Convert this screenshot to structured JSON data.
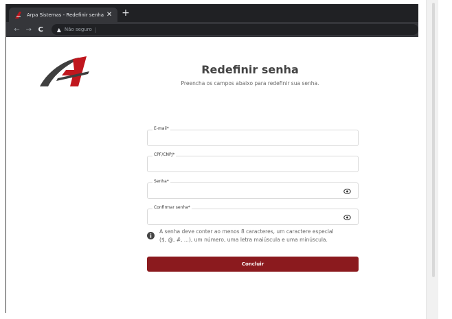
{
  "browser": {
    "tab_title": "Arpa Sistemas - Redefinir senha",
    "tab_close": "✕",
    "new_tab": "+",
    "back": "←",
    "forward": "→",
    "reload": "C",
    "security_warning": "▲",
    "security_label": "Não seguro",
    "url_separator": "|"
  },
  "page": {
    "logo_name": "arpa-logo",
    "title": "Redefinir senha",
    "subtitle": "Preencha os campos abaixo para redefinir sua senha."
  },
  "form": {
    "email_label": "E-mail*",
    "email_value": "",
    "cpf_label": "CPF/CNPJ*",
    "cpf_value": "",
    "password_label": "Senha*",
    "password_value": "",
    "confirm_label": "Confirmar senha*",
    "confirm_value": "",
    "info_line1": "A senha deve conter ao menos 8 caracteres, um caractere especial",
    "info_line2": "($, @, #, ...), um número, uma letra maiúscula e uma minúscula.",
    "submit_label": "Concluir"
  },
  "colors": {
    "brand_red": "#8b1a1e",
    "logo_gray": "#3f3f3f",
    "logo_red": "#c0171e"
  }
}
